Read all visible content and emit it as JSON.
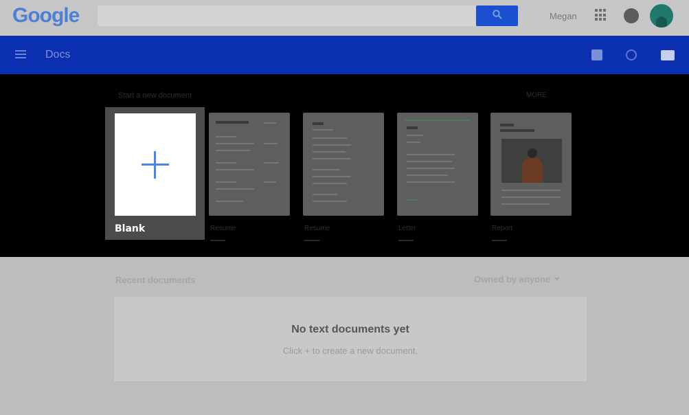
{
  "google_bar": {
    "logo_text": "Google",
    "user_name": "Megan",
    "accent": "#1a4fd0"
  },
  "docs_bar": {
    "title": "Docs",
    "color": "#0a2fb0"
  },
  "template_gallery": {
    "heading": "Start a new document",
    "more_link": "MORE",
    "blank": {
      "label": "Blank"
    },
    "templates": [
      {
        "name": "Resume",
        "sub": ""
      },
      {
        "name": "Resume",
        "sub": ""
      },
      {
        "name": "Letter",
        "sub": ""
      },
      {
        "name": "Report",
        "sub": ""
      }
    ]
  },
  "recent": {
    "title": "Recent documents",
    "owner_filter": "Owned by anyone",
    "empty_title": "No text documents yet",
    "empty_subtitle": "Click + to create a new document."
  }
}
